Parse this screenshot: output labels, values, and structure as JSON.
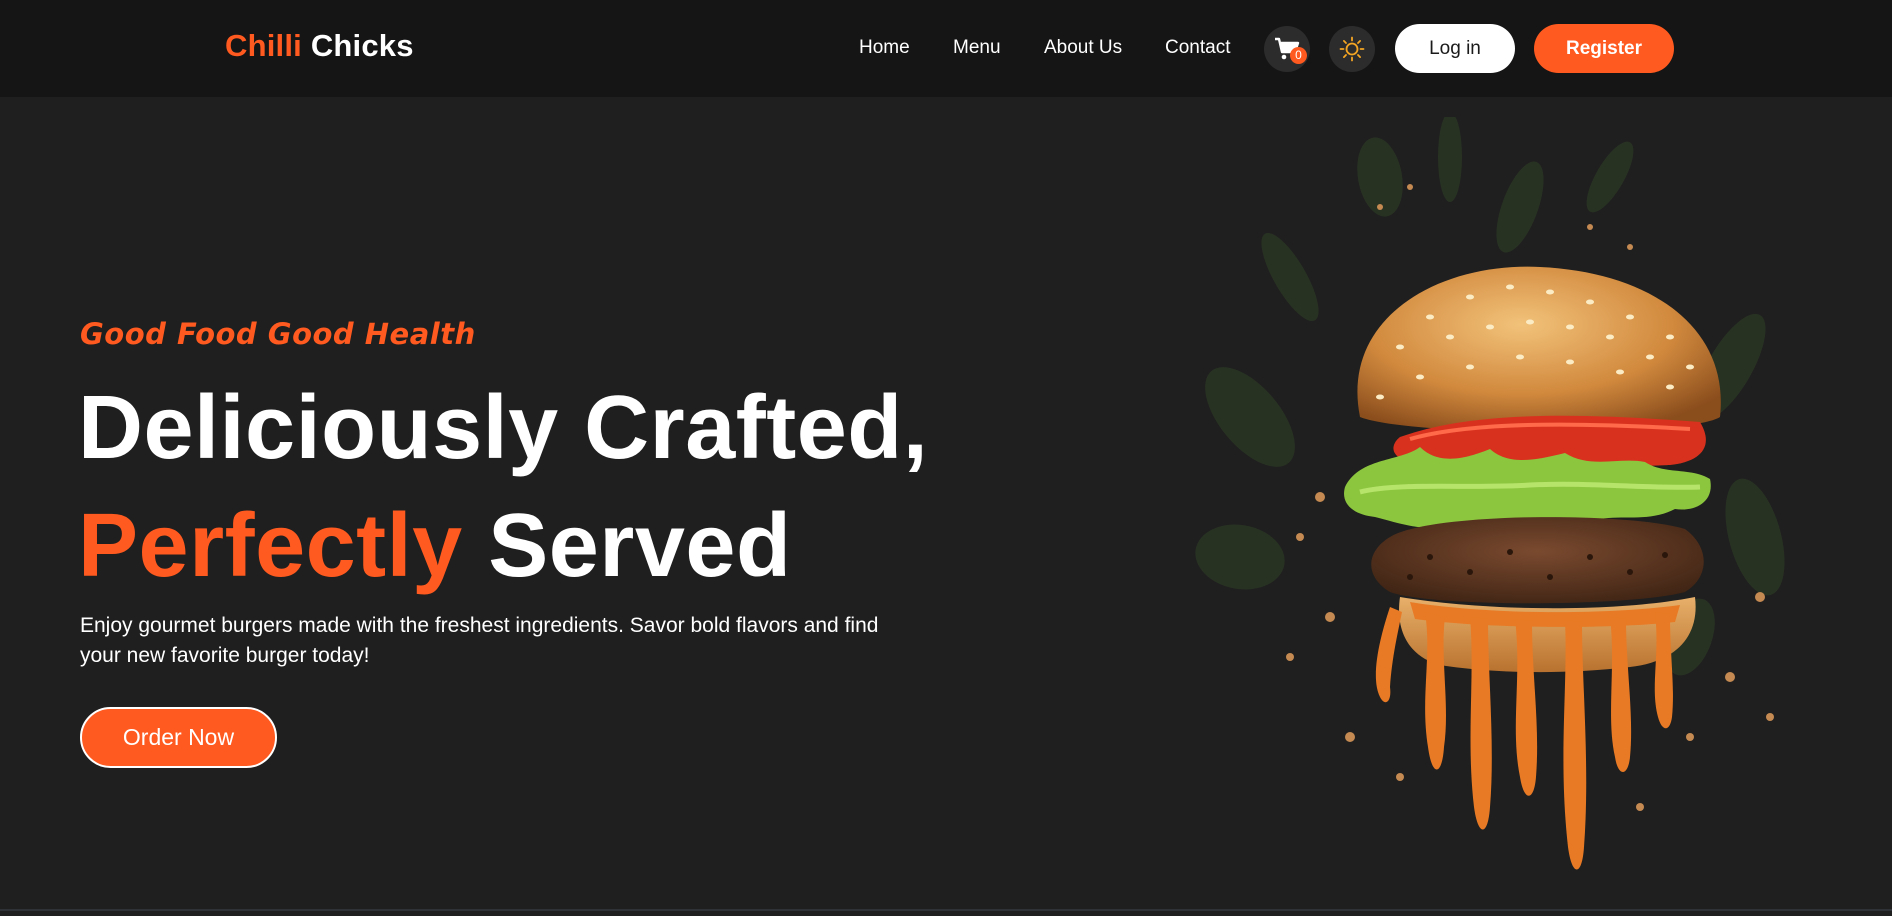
{
  "brand": {
    "name_accent": "Chilli",
    "name_rest": "Chicks"
  },
  "nav": {
    "links": [
      "Home",
      "Menu",
      "About Us",
      "Contact"
    ],
    "cart_count": "0",
    "login_label": "Log in",
    "register_label": "Register"
  },
  "hero": {
    "tagline": "Good Food Good Health",
    "headline_line1": "Deliciously Crafted,",
    "headline_accent": "Perfectly",
    "headline_rest": " Served",
    "description": "Enjoy gourmet burgers made with the freshest ingredients. Savor bold flavors and find your new favorite burger today!",
    "cta_label": "Order Now"
  },
  "icons": {
    "cart": "cart-icon",
    "theme": "sun-icon"
  },
  "colors": {
    "accent": "#ff5a1f",
    "background": "#1f1f1f",
    "navbar": "#151515"
  }
}
